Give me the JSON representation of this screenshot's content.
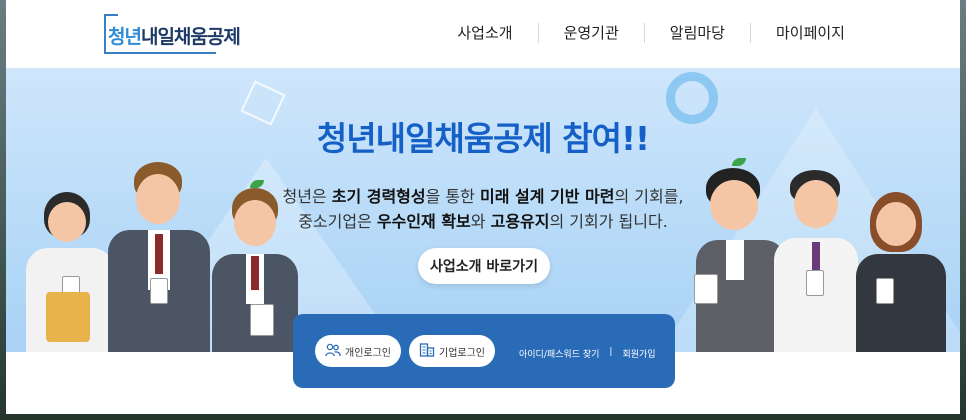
{
  "header": {
    "logo_text": "청년내일채움공제",
    "nav": [
      "사업소개",
      "운영기관",
      "알림마당",
      "마이페이지"
    ]
  },
  "hero": {
    "title": "청년내일채움공제 참여!!",
    "desc_line1": {
      "p1": "청년은 ",
      "b1": "초기 경력형성",
      "p2": "을 통한 ",
      "b2": "미래 설계 기반 마련",
      "p3": "의 기회를,"
    },
    "desc_line2": {
      "p1": "중소기업은 ",
      "b1": "우수인재 확보",
      "p2": "와 ",
      "b2": "고용유지",
      "p3": "의 기회가 됩니다."
    },
    "cta_label": "사업소개 바로가기"
  },
  "login": {
    "personal_label": "개인로그인",
    "company_label": "기업로그인",
    "find_label": "아이디/패스워드 찾기",
    "divider": "|",
    "join_label": "회원가입"
  },
  "colors": {
    "accent": "#1560c7",
    "login_panel": "#2a6bb8"
  }
}
